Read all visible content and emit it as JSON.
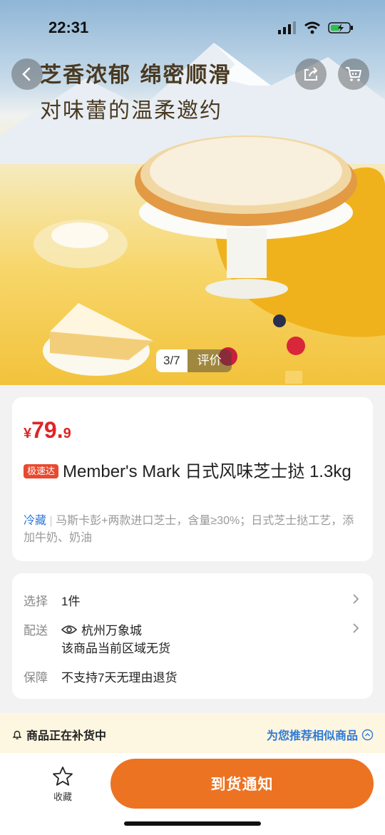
{
  "status": {
    "time": "22:31"
  },
  "hero": {
    "headline_1": "芝香浓郁 绵密顺滑",
    "headline_2": "对味蕾的温柔邀约",
    "image_counter": "3/7",
    "review_tab": "评价"
  },
  "product": {
    "currency": "¥",
    "price_int": "79.",
    "price_dec": "9",
    "badge": "极速达",
    "title": "Member's Mark 日式风味芝士挞 1.3kg",
    "tag_cold": "冷藏",
    "description": "马斯卡彭+两款进口芝士，含量≥30%；日式芝士挞工艺，添加牛奶、奶油"
  },
  "options": {
    "select_label": "选择",
    "select_value": "1件",
    "delivery_label": "配送",
    "delivery_location": "杭州万象城",
    "delivery_status": "该商品当前区域无货",
    "guarantee_label": "保障",
    "guarantee_value": "不支持7天无理由退货"
  },
  "notice": {
    "restock": "商品正在补货中",
    "recommend": "为您推荐相似商品"
  },
  "bottom_bar": {
    "favorite": "收藏",
    "notify": "到货通知"
  },
  "colors": {
    "price": "#e02424",
    "accent": "#ec7322",
    "link": "#2f7ad6"
  }
}
